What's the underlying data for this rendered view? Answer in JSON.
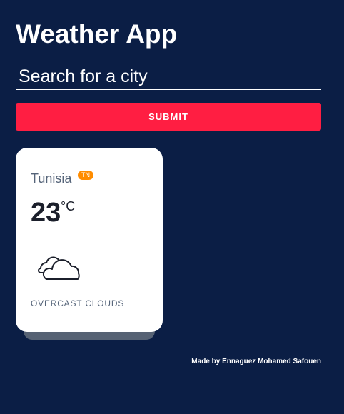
{
  "app": {
    "title": "Weather App"
  },
  "search": {
    "placeholder": "Search for a city",
    "value": ""
  },
  "submit": {
    "label": "SUBMIT"
  },
  "weather_card": {
    "city": "Tunisia",
    "country_code": "TN",
    "temperature": "23",
    "unit": "°C",
    "icon": "cloud-icon",
    "description": "OVERCAST CLOUDS"
  },
  "footer": {
    "credit": "Made by Ennaguez Mohamed Safouen"
  },
  "colors": {
    "background": "#0b1e45",
    "accent": "#ff1e42",
    "badge": "#ff8c00",
    "card": "#ffffff",
    "muted_text": "#556479"
  }
}
